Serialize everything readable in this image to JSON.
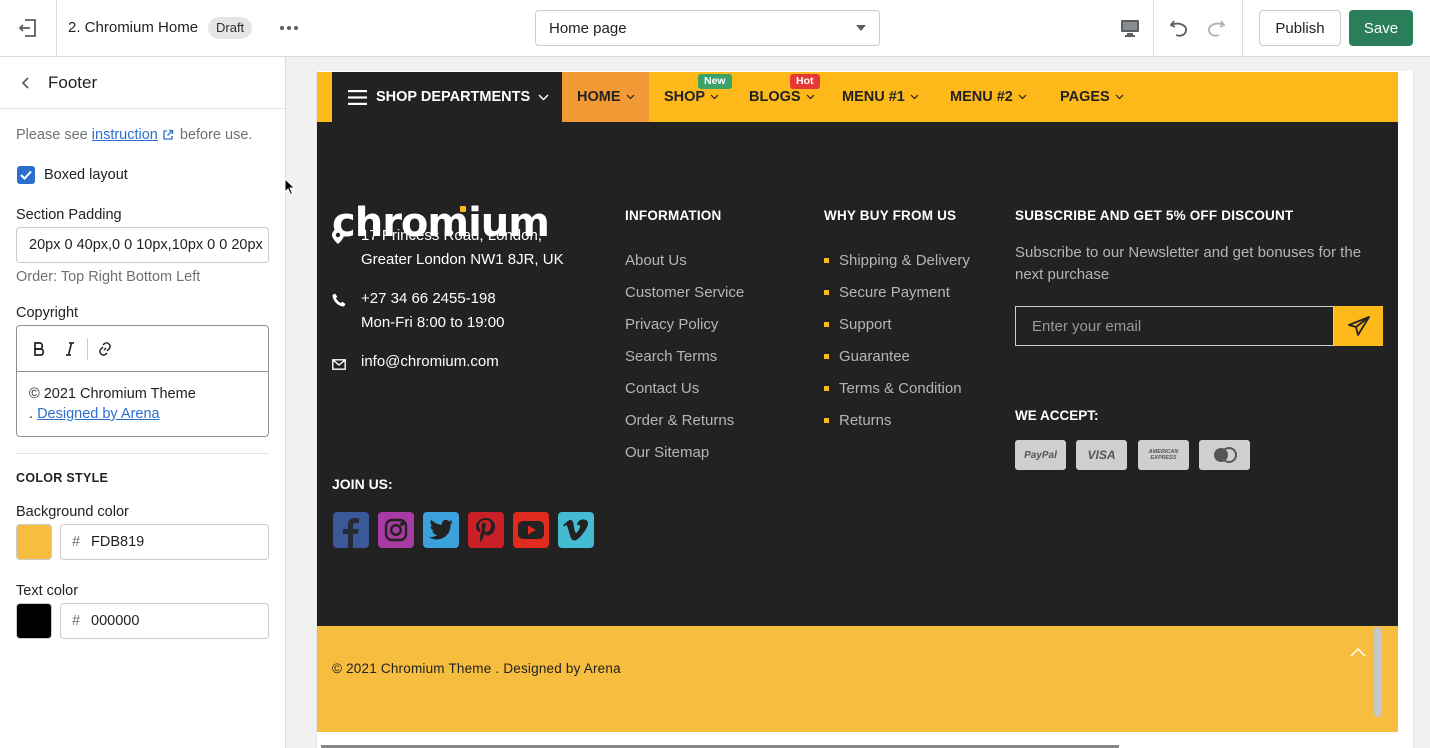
{
  "topbar": {
    "theme_name": "2. Chromium Home",
    "status_badge": "Draft",
    "page_select": "Home page",
    "publish_label": "Publish",
    "save_label": "Save",
    "accent_color": "#2a7e5a"
  },
  "sidebar": {
    "title": "Footer",
    "instruction_prefix": "Please see",
    "instruction_link": "instruction",
    "instruction_suffix": "before use.",
    "boxed_layout_label": "Boxed layout",
    "boxed_layout_checked": true,
    "section_padding_label": "Section Padding",
    "section_padding_value": "20px 0 40px,0 0 10px,10px 0 0 20px",
    "section_padding_hint": "Order: Top Right Bottom Left",
    "copyright_label": "Copyright",
    "copyright_text": "© 2021 Chromium Theme",
    "copyright_prefix": ". ",
    "copyright_link": "Designed by Arena",
    "color_style_heading": "COLOR STYLE",
    "background_color_label": "Background color",
    "background_color_hash": "#",
    "background_color_value": "FDB819",
    "background_color_swatch": "#f6bd3e",
    "text_color_label": "Text color",
    "text_color_hash": "#",
    "text_color_value": "000000",
    "text_color_swatch": "#000000"
  },
  "preview": {
    "nav": {
      "departments": "SHOP DEPARTMENTS",
      "items": [
        "HOME",
        "SHOP",
        "BLOGS",
        "MENU #1",
        "MENU #2",
        "PAGES"
      ],
      "badge_new": "New",
      "badge_hot": "Hot"
    },
    "footer": {
      "logo": "chromium",
      "address_line1": "17 Princess Road, London,",
      "address_line2": "Greater London NW1 8JR, UK",
      "phone_line1": "+27 34 66 2455-198",
      "phone_line2": "Mon-Fri 8:00 to 19:00",
      "email": "info@chromium.com",
      "join_heading": "JOIN US:",
      "social": [
        "facebook",
        "instagram",
        "twitter",
        "pinterest",
        "youtube",
        "vimeo"
      ],
      "information_heading": "INFORMATION",
      "information_links": [
        "About Us",
        "Customer Service",
        "Privacy Policy",
        "Search Terms",
        "Contact Us",
        "Order & Returns",
        "Our Sitemap"
      ],
      "why_heading": "WHY BUY FROM US",
      "why_links": [
        "Shipping & Delivery",
        "Secure Payment",
        "Support",
        "Guarantee",
        "Terms & Condition",
        "Returns"
      ],
      "subscribe_heading": "SUBSCRIBE AND GET 5% OFF DISCOUNT",
      "subscribe_text": "Subscribe to our Newsletter and get bonuses for the next purchase",
      "email_placeholder": "Enter your email",
      "accept_heading": "WE ACCEPT:",
      "payments": [
        "PayPal",
        "VISA",
        "AMERICAN EXPRESS",
        "MasterCard"
      ],
      "copyright": "© 2021 Chromium Theme . Designed by Arena"
    }
  }
}
